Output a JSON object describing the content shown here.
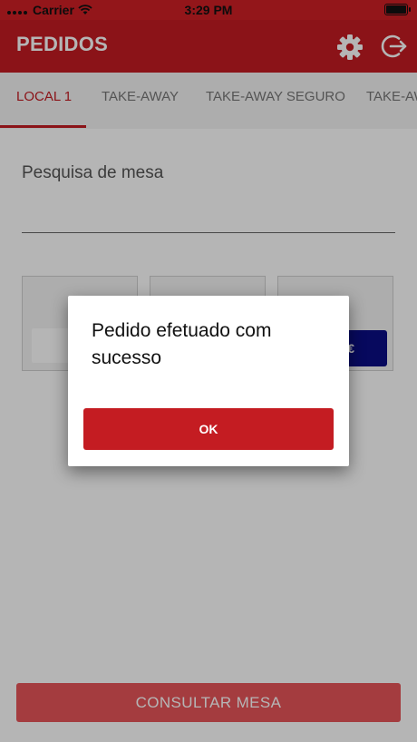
{
  "status_bar": {
    "carrier": "Carrier",
    "time": "3:29 PM"
  },
  "app_bar": {
    "title": "PEDIDOS"
  },
  "tabs": [
    {
      "label": "LOCAL 1",
      "active": true
    },
    {
      "label": "TAKE-AWAY",
      "active": false
    },
    {
      "label": "TAKE-AWAY SEGURO",
      "active": false
    },
    {
      "label": "TAKE-AW",
      "active": false
    }
  ],
  "search": {
    "label": "Pesquisa de mesa"
  },
  "cards": {
    "blue_button_text": "€"
  },
  "consult_button": {
    "label": "CONSULTAR MESA"
  },
  "dialog": {
    "message": "Pedido efetuado com sucesso",
    "ok_label": "OK"
  },
  "colors": {
    "primary": "#c41c22",
    "status_bar": "#d01f25",
    "blue_button": "#0b0d85",
    "overlay": "rgba(0,0,0,0.29)"
  },
  "icons": [
    "wifi-icon",
    "battery-icon",
    "gear-icon",
    "logout-icon"
  ]
}
